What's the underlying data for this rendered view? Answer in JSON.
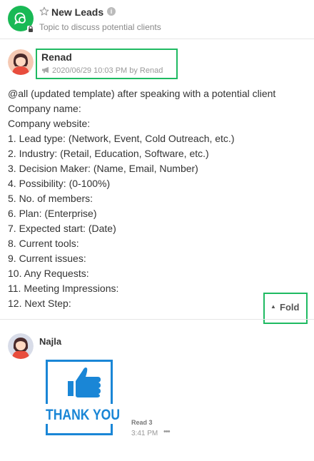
{
  "topic": {
    "title": "New Leads",
    "description": "Topic to discuss potential clients",
    "accent_color": "#19b955"
  },
  "post": {
    "author": "Renad",
    "meta": "2020/06/29 10:03 PM by Renad",
    "lines": [
      "@all (updated template) after speaking with a potential client",
      "Company name:",
      "Company website:",
      "1. Lead type: (Network, Event, Cold Outreach, etc.)",
      "2. Industry: (Retail, Education, Software, etc.)",
      "3. Decision Maker: (Name, Email, Number)",
      "4. Possibility: (0-100%)",
      "5. No. of members:",
      "6. Plan: (Enterprise)",
      "7. Expected start: (Date)",
      "8. Current tools:",
      "9. Current issues:",
      "10. Any Requests:",
      "11. Meeting Impressions:",
      "12. Next Step:"
    ],
    "fold_label": "Fold",
    "highlight_color": "#1fba62"
  },
  "reply": {
    "author": "Najla",
    "sticker_text": "THANK YOU",
    "read_label": "Read 3",
    "time": "3:41 PM",
    "sticker_color": "#1a86d6"
  }
}
